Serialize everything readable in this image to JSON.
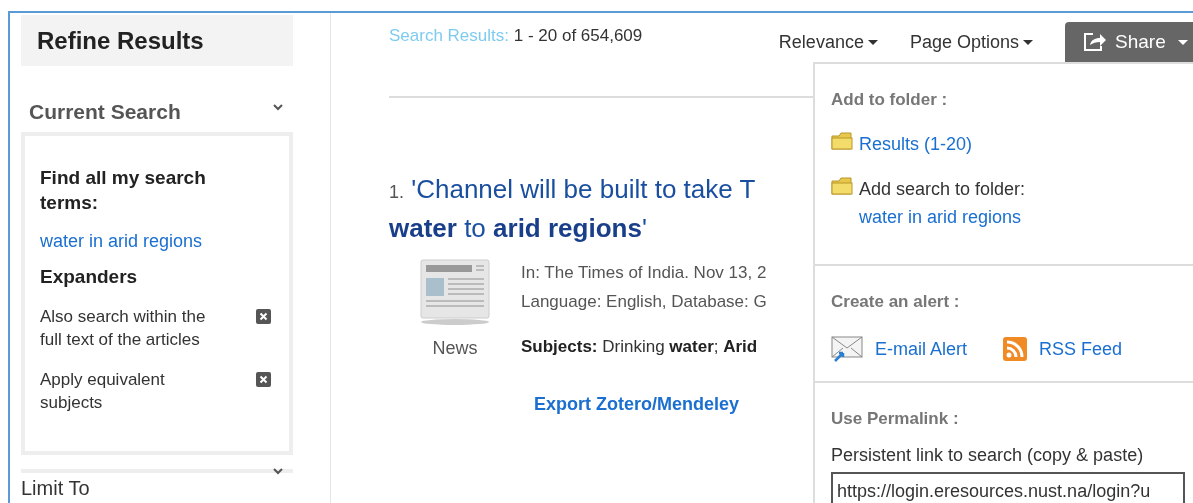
{
  "sidebar": {
    "title": "Refine Results",
    "current_search": {
      "heading": "Current Search",
      "label": "Find all my search terms:",
      "query": "water in arid regions",
      "expanders_heading": "Expanders",
      "expanders": [
        "Also search within the full text of the articles",
        "Apply equivalent subjects"
      ]
    },
    "limit_to": {
      "heading": "Limit To"
    }
  },
  "toolbar": {
    "results_label": "Search Results:",
    "results_count": "1 - 20 of 654,609",
    "menus": [
      "Relevance",
      "Page Options"
    ],
    "share": "Share"
  },
  "results": [
    {
      "number": "1.",
      "title_lines": [
        "'Channel will be built to take T",
        "**water** to **arid regions**'"
      ],
      "type_label": "News",
      "meta": [
        "In: The Times of India. Nov 13, 2",
        "Language: English, Database: G"
      ],
      "subjects": "**Subjects:** Drinking **water**; **Arid**",
      "export": "Export Zotero/Mendeley"
    }
  ],
  "share_menu": {
    "folder_heading": "Add to folder :",
    "results_link": "Results (1-20)",
    "add_search_label": "Add search to folder:",
    "add_search_link": "water in arid regions",
    "alert_heading": "Create an alert :",
    "alerts": [
      {
        "kind": "email",
        "label": "E-mail Alert"
      },
      {
        "kind": "rss",
        "label": "RSS Feed"
      }
    ],
    "permalink_heading": "Use Permalink :",
    "permalink_label": "Persistent link to search (copy & paste)",
    "permalink_url": "https://login.eresources.nust.na/login?u"
  }
}
